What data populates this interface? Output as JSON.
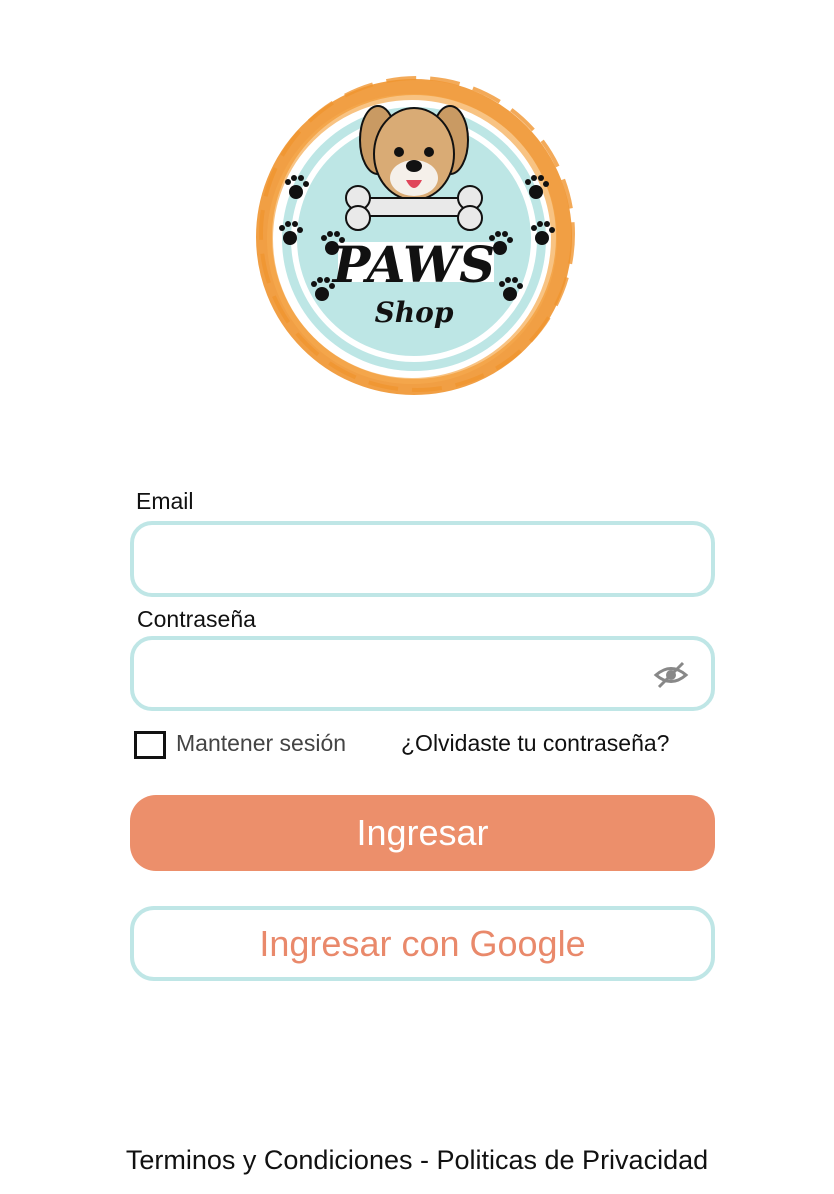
{
  "logo": {
    "title": "PAWS",
    "subtitle": "Shop"
  },
  "form": {
    "email_label": "Email",
    "email_value": "",
    "password_label": "Contraseña",
    "password_value": "",
    "remember_label": "Mantener sesión",
    "remember_checked": false,
    "forgot_label": "¿Olvidaste tu contraseña?"
  },
  "buttons": {
    "login_label": "Ingresar",
    "google_label": "Ingresar con Google"
  },
  "footer": {
    "terms_label": "Terminos y Condiciones",
    "separator": " - ",
    "privacy_label": "Politicas de Privacidad"
  },
  "icons": {
    "password_toggle": "eye-off-icon"
  },
  "colors": {
    "accent": "#ec8f6b",
    "input_border": "#bfe6e6",
    "logo_ring": "#f09530",
    "logo_fill": "#bde6e5"
  }
}
